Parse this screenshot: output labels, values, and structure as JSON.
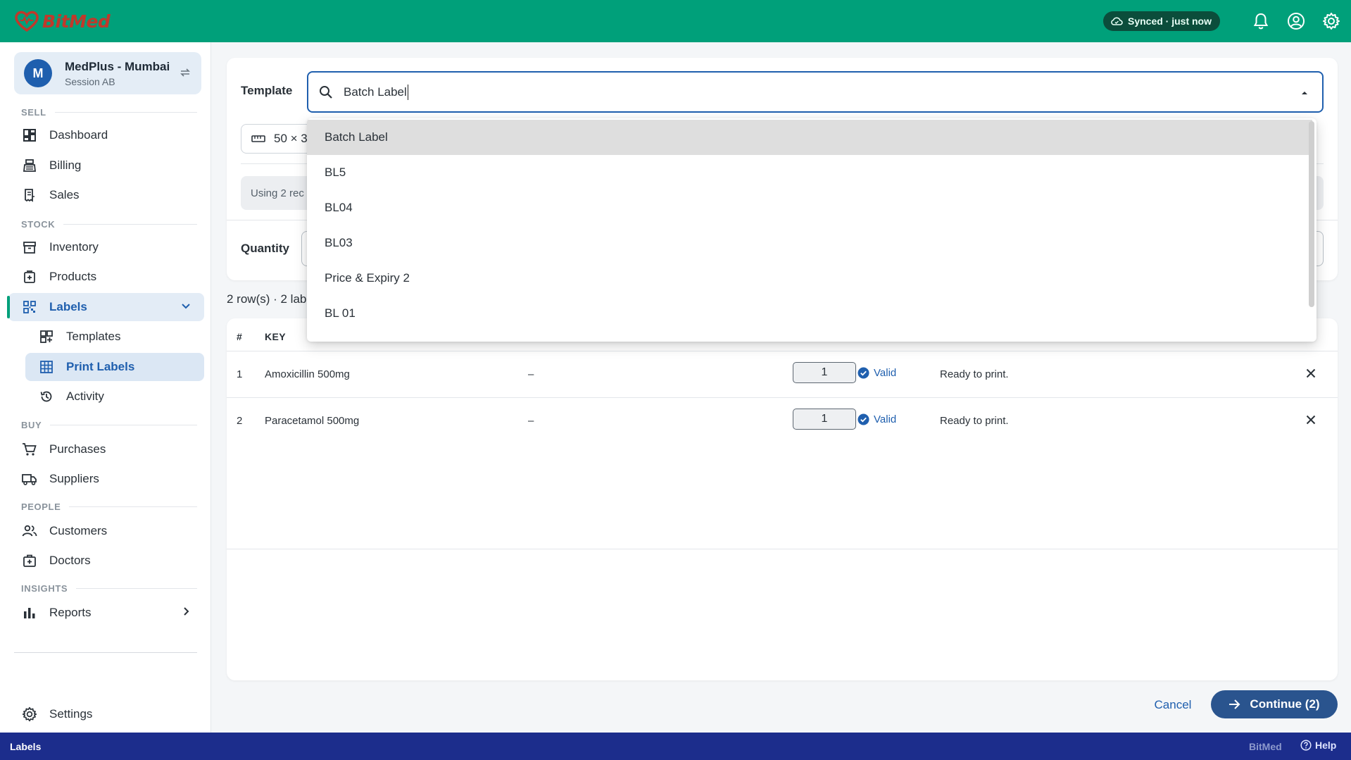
{
  "app": {
    "name": "BitMed"
  },
  "topbar": {
    "sync_status": "Synced · just now"
  },
  "store": {
    "avatar_letter": "M",
    "name": "MedPlus - Mumbai",
    "session": "Session AB"
  },
  "sidebar": {
    "sections": {
      "sell": "SELL",
      "stock": "STOCK",
      "buy": "BUY",
      "people": "PEOPLE",
      "insights": "INSIGHTS"
    },
    "items": {
      "dashboard": "Dashboard",
      "billing": "Billing",
      "sales": "Sales",
      "inventory": "Inventory",
      "products": "Products",
      "labels": "Labels",
      "templates": "Templates",
      "print_labels": "Print Labels",
      "activity": "Activity",
      "purchases": "Purchases",
      "suppliers": "Suppliers",
      "customers": "Customers",
      "doctors": "Doctors",
      "reports": "Reports",
      "settings": "Settings"
    }
  },
  "form": {
    "template_label": "Template",
    "template_value": "Batch Label",
    "size_chip": "50 × 3",
    "info_text": "Using 2 rec",
    "quantity_label": "Quantity"
  },
  "dropdown": {
    "options": [
      "Batch Label",
      "BL5",
      "BL04",
      "BL03",
      "Price & Expiry 2",
      "BL 01"
    ]
  },
  "summary": "2 row(s) · 2 lab",
  "table": {
    "headers": {
      "num": "#",
      "key": "KEY"
    },
    "rows": [
      {
        "num": "1",
        "name": "Amoxicillin 500mg",
        "dash": "–",
        "qty": "1",
        "valid": "Valid",
        "status": "Ready to print."
      },
      {
        "num": "2",
        "name": "Paracetamol 500mg",
        "dash": "–",
        "qty": "1",
        "valid": "Valid",
        "status": "Ready to print."
      }
    ]
  },
  "actions": {
    "cancel": "Cancel",
    "continue": "Continue (2)"
  },
  "statusbar": {
    "page": "Labels",
    "brand": "BitMed",
    "help": "Help"
  },
  "colors": {
    "topbar": "#00a07a",
    "accent": "#1f5fae",
    "primary_button": "#2a548e",
    "statusbar": "#1c2d8c"
  }
}
